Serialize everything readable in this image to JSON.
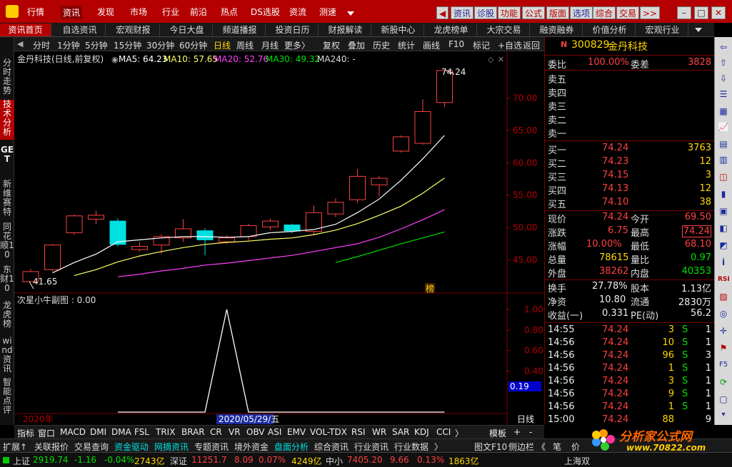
{
  "menu": {
    "items": [
      "行情",
      "资讯",
      "发现",
      "市场",
      "行业",
      "前沿",
      "热点",
      "DS选股",
      "资流",
      "测速"
    ],
    "active": "资讯",
    "toolbar": [
      "资讯",
      "诊股",
      "功能",
      "公式",
      "版面",
      "选项",
      "综合",
      "交易"
    ],
    "back_arrow": "◀",
    "more_arrow": ">>"
  },
  "tabs": [
    "资讯首页",
    "自选资讯",
    "宏观财报",
    "今日大盘",
    "频道播报",
    "投资日历",
    "财报解读",
    "新股中心",
    "龙虎榜单",
    "大宗交易",
    "融资融券",
    "价值分析",
    "宏观行业"
  ],
  "left_tabs": [
    "分时走势",
    "技术分析",
    "GET",
    "新维赛特",
    "同花顺10",
    "东财10",
    "龙虎榜",
    "wind资讯",
    "智能点评"
  ],
  "chart_toolbar": {
    "periods": [
      "分时",
      "1分钟",
      "5分钟",
      "15分钟",
      "30分钟",
      "60分钟",
      "日线",
      "周线",
      "月线",
      "更多〉"
    ],
    "active_period": "日线",
    "tools": [
      "复权",
      "叠加",
      "历史",
      "统计",
      "画线",
      "F10",
      "标记",
      "+自选",
      "返回"
    ]
  },
  "main_chart": {
    "header": "金丹科技(日线,前复权)",
    "ma5": "MA5: 64.23",
    "ma10": "MA10: 57.65",
    "ma20": "MA20: 52.76",
    "ma30": "MA30: 49.32",
    "ma240": "MA240: -",
    "high_label": "74.24",
    "low_label": "41.65",
    "badge": "榜"
  },
  "sub_chart": {
    "header": "次星小牛副图 : 0.00",
    "current_value": "0.19",
    "year_label": "2020年",
    "date_label": "2020/05/29/五",
    "period_label": "日线"
  },
  "chart_data": {
    "type": "candlestick",
    "price_ticks": [
      45,
      50,
      55,
      60,
      65,
      70
    ],
    "price_tick_labels": [
      "45.00",
      "50.00",
      "55.00",
      "60.00",
      "65.00",
      "70.00"
    ],
    "ylim": [
      40,
      75
    ],
    "candles": [
      {
        "o": 41.65,
        "c": 43.2,
        "h": 43.6,
        "l": 41.65
      },
      {
        "o": 43.5,
        "c": 47.3,
        "h": 47.5,
        "l": 43.2
      },
      {
        "o": 49.2,
        "c": 51.8,
        "h": 52.0,
        "l": 48.9
      },
      {
        "o": 51.3,
        "c": 51.9,
        "h": 52.6,
        "l": 50.5
      },
      {
        "o": 51.0,
        "c": 47.4,
        "h": 51.4,
        "l": 47.1
      },
      {
        "o": 46.6,
        "c": 47.1,
        "h": 47.8,
        "l": 46.3
      },
      {
        "o": 47.3,
        "c": 48.6,
        "h": 49.0,
        "l": 45.9
      },
      {
        "o": 48.4,
        "c": 49.8,
        "h": 51.3,
        "l": 47.8
      },
      {
        "o": 49.5,
        "c": 48.1,
        "h": 49.9,
        "l": 45.7
      },
      {
        "o": 47.8,
        "c": 48.4,
        "h": 48.8,
        "l": 47.5
      },
      {
        "o": 48.6,
        "c": 50.3,
        "h": 50.6,
        "l": 48.0
      },
      {
        "o": 50.1,
        "c": 51.0,
        "h": 51.4,
        "l": 49.6
      },
      {
        "o": 50.4,
        "c": 49.5,
        "h": 50.6,
        "l": 49.1
      },
      {
        "o": 49.4,
        "c": 52.3,
        "h": 53.4,
        "l": 48.8
      },
      {
        "o": 52.1,
        "c": 53.9,
        "h": 54.5,
        "l": 51.6
      },
      {
        "o": 54.3,
        "c": 57.9,
        "h": 59.0,
        "l": 53.8
      },
      {
        "o": 56.6,
        "c": 57.6,
        "h": 58.0,
        "l": 54.8
      },
      {
        "o": 61.8,
        "c": 64.0,
        "h": 64.2,
        "l": 61.6
      },
      {
        "o": 63.0,
        "c": 67.9,
        "h": 69.8,
        "l": 62.8
      },
      {
        "o": 69.3,
        "c": 74.24,
        "h": 74.24,
        "l": 68.6
      }
    ],
    "ma5": [
      null,
      43.0,
      44.6,
      45.9,
      47.8,
      48.1,
      48.4,
      48.6,
      48.6,
      48.5,
      48.6,
      49.2,
      49.4,
      49.7,
      50.5,
      52.3,
      54.4,
      57.3,
      60.6,
      64.23
    ],
    "ma10": [
      null,
      null,
      42.6,
      43.5,
      44.7,
      45.6,
      46.3,
      46.9,
      47.4,
      47.7,
      47.9,
      48.2,
      48.4,
      48.9,
      49.6,
      50.6,
      51.9,
      53.3,
      55.3,
      57.65
    ],
    "ma20": [
      null,
      null,
      null,
      null,
      42.4,
      42.8,
      43.3,
      43.7,
      44.2,
      44.5,
      44.9,
      45.3,
      45.7,
      46.3,
      46.9,
      47.5,
      48.5,
      49.8,
      51.2,
      52.76
    ],
    "ma30": [
      null,
      null,
      null,
      null,
      null,
      null,
      null,
      null,
      null,
      null,
      null,
      null,
      null,
      null,
      44.6,
      45.5,
      46.5,
      47.5,
      48.4,
      49.32
    ],
    "sub_ticks": [
      0.4,
      0.6,
      0.8,
      1.0
    ],
    "sub_tick_labels": [
      "0.40",
      "0.60",
      "0.80",
      "1.00"
    ],
    "sub_values": [
      0,
      0,
      0,
      0,
      0,
      0,
      0,
      0,
      0,
      1,
      0,
      0,
      0,
      0,
      0,
      0,
      0,
      0,
      0,
      0
    ]
  },
  "quote": {
    "code": "300829",
    "name": "金丹科技",
    "weibi_label": "委比",
    "weibi_value": "100.00%",
    "weicha_label": "委差",
    "weicha_value": "3828",
    "sell": [
      "卖五",
      "卖四",
      "卖三",
      "卖二",
      "卖一"
    ],
    "buy": [
      {
        "label": "买一",
        "price": "74.24",
        "vol": "3763"
      },
      {
        "label": "买二",
        "price": "74.23",
        "vol": "12"
      },
      {
        "label": "买三",
        "price": "74.15",
        "vol": "3"
      },
      {
        "label": "买四",
        "price": "74.13",
        "vol": "12"
      },
      {
        "label": "买五",
        "price": "74.10",
        "vol": "38"
      }
    ],
    "stats": [
      {
        "l1": "现价",
        "v1": "74.24",
        "l2": "今开",
        "v2": "69.50"
      },
      {
        "l1": "涨跌",
        "v1": "6.75",
        "l2": "最高",
        "v2": "74.24"
      },
      {
        "l1": "涨幅",
        "v1": "10.00%",
        "l2": "最低",
        "v2": "68.10"
      },
      {
        "l1": "总量",
        "v1": "78615",
        "l2": "量比",
        "v2": "0.97"
      },
      {
        "l1": "外盘",
        "v1": "38262",
        "l2": "内盘",
        "v2": "40353"
      }
    ],
    "fin": [
      {
        "l1": "换手",
        "v1": "27.78%",
        "l2": "股本",
        "v2": "1.13亿"
      },
      {
        "l1": "净资",
        "v1": "10.80",
        "l2": "流通",
        "v2": "2830万"
      },
      {
        "l1": "收益(一)",
        "v1": "0.331",
        "l2": "PE(动)",
        "v2": "56.2"
      }
    ],
    "ticks": [
      {
        "t": "14:55",
        "p": "74.24",
        "v": "3",
        "s": "S",
        "n": "1"
      },
      {
        "t": "14:56",
        "p": "74.24",
        "v": "10",
        "s": "S",
        "n": "1"
      },
      {
        "t": "14:56",
        "p": "74.24",
        "v": "96",
        "s": "S",
        "n": "3"
      },
      {
        "t": "14:56",
        "p": "74.24",
        "v": "1",
        "s": "S",
        "n": "1"
      },
      {
        "t": "14:56",
        "p": "74.24",
        "v": "3",
        "s": "S",
        "n": "1"
      },
      {
        "t": "14:56",
        "p": "74.24",
        "v": "9",
        "s": "S",
        "n": "1"
      },
      {
        "t": "14:56",
        "p": "74.24",
        "v": "1",
        "s": "S",
        "n": "1"
      },
      {
        "t": "15:00",
        "p": "74.24",
        "v": "88",
        "s": "",
        "n": "9"
      }
    ]
  },
  "indicators": [
    "指标",
    "窗口",
    "MACD",
    "DMI",
    "DMA",
    "FSL",
    "TRIX",
    "BRAR",
    "CR",
    "VR",
    "OBV",
    "ASI",
    "EMV",
    "VOL-TDX",
    "RSI",
    "WR",
    "SAR",
    "KDJ",
    "CCI"
  ],
  "ind_extra": {
    "more": "〉",
    "template": "模板",
    "plus": "+",
    "minus": "-"
  },
  "func_bar": [
    "扩展↑",
    "关联报价",
    "交易查询",
    "资金驱动",
    "网摘资讯",
    "专题资讯",
    "境外资金",
    "盘面分析",
    "综合资讯",
    "行业资讯",
    "行业数据"
  ],
  "func_right": [
    "〉",
    "图文F10",
    "侧边栏",
    "《",
    "笔",
    "价"
  ],
  "status": {
    "sh_name": "上证",
    "sh_val": "2919.74",
    "sh_chg": "-1.16",
    "sh_pct": "-0.04%",
    "sh_amt": "2743亿",
    "sz_name": "深证",
    "sz_val": "11251.7",
    "sz_chg": "8.09",
    "sz_pct": "0.07%",
    "sz_amt": "4249亿",
    "zx_name": "中小",
    "zx_val": "7405.20",
    "zx_chg": "9.66",
    "zx_pct": "0.13%",
    "zx_amt": "1863亿",
    "right": "上海双"
  },
  "watermark": {
    "title": "分析家公式网",
    "url": "www.70822.com"
  },
  "colors": {
    "up": "#ff4040",
    "down": "#00e0e0",
    "ma5": "#ffffff",
    "ma10": "#ffff66",
    "ma20": "#ff40ff",
    "ma30": "#00e000",
    "brand": "#b40000"
  }
}
